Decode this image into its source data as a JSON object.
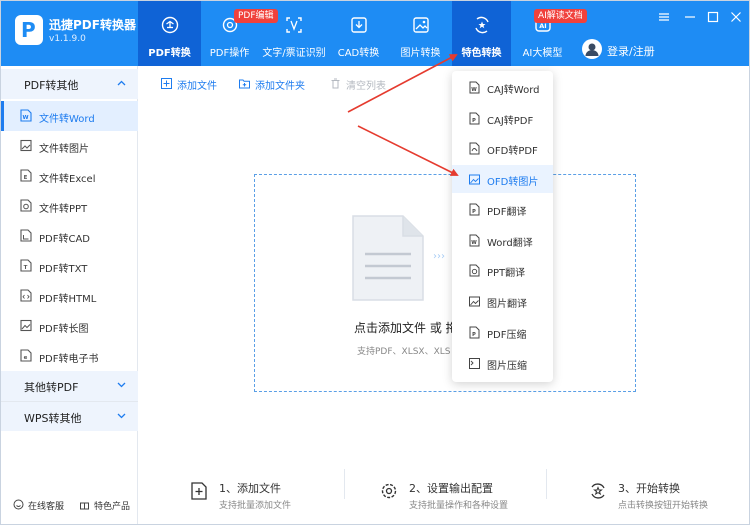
{
  "app": {
    "title": "迅捷PDF转换器",
    "version": "v1.1.9.0",
    "logo_letter": "P"
  },
  "nav": [
    {
      "label": "PDF转换",
      "icon": "refresh-icon",
      "active": true
    },
    {
      "label": "PDF操作",
      "icon": "gear-icon",
      "badge": "PDF编辑"
    },
    {
      "label": "文字/票证识别",
      "icon": "scan-icon"
    },
    {
      "label": "CAD转换",
      "icon": "download-box-icon"
    },
    {
      "label": "图片转换",
      "icon": "image-icon"
    },
    {
      "label": "特色转换",
      "icon": "star-refresh-icon",
      "active_dropdown": true
    },
    {
      "label": "AI大模型",
      "icon": "ai-icon",
      "badge": "AI解读文档"
    }
  ],
  "login": {
    "label": "登录/注册"
  },
  "sidebar": {
    "group1": {
      "label": "PDF转其他",
      "expanded": true
    },
    "items": [
      {
        "label": "文件转Word",
        "icon": "word-file-icon",
        "active": true
      },
      {
        "label": "文件转图片",
        "icon": "image-file-icon"
      },
      {
        "label": "文件转Excel",
        "icon": "excel-file-icon"
      },
      {
        "label": "文件转PPT",
        "icon": "ppt-file-icon"
      },
      {
        "label": "PDF转CAD",
        "icon": "cad-file-icon"
      },
      {
        "label": "PDF转TXT",
        "icon": "txt-file-icon"
      },
      {
        "label": "PDF转HTML",
        "icon": "html-file-icon"
      },
      {
        "label": "PDF转长图",
        "icon": "long-image-icon"
      },
      {
        "label": "PDF转电子书",
        "icon": "ebook-icon"
      }
    ],
    "group2": {
      "label": "其他转PDF"
    },
    "group3": {
      "label": "WPS转其他"
    },
    "footer": {
      "service": "在线客服",
      "products": "特色产品"
    }
  },
  "toolbar": {
    "add_file": "添加文件",
    "add_folder": "添加文件夹",
    "clear_list": "清空列表"
  },
  "dropzone": {
    "title": "点击添加文件 或 拖",
    "subtitle": "支持PDF、XLSX、XLS"
  },
  "steps": [
    {
      "title": "1、添加文件",
      "sub": "支持批量添加文件"
    },
    {
      "title": "2、设置输出配置",
      "sub": "支持批量操作和各种设置"
    },
    {
      "title": "3、开始转换",
      "sub": "点击转换按钮开始转换"
    }
  ],
  "dropdown": [
    {
      "label": "CAJ转Word",
      "icon": "word-icon"
    },
    {
      "label": "CAJ转PDF",
      "icon": "pdf-icon"
    },
    {
      "label": "OFD转PDF",
      "icon": "pdf-icon"
    },
    {
      "label": "OFD转图片",
      "icon": "image-icon",
      "highlighted": true
    },
    {
      "label": "PDF翻译",
      "icon": "pdf-icon"
    },
    {
      "label": "Word翻译",
      "icon": "word-icon"
    },
    {
      "label": "PPT翻译",
      "icon": "ppt-icon"
    },
    {
      "label": "图片翻译",
      "icon": "image-icon"
    },
    {
      "label": "PDF压缩",
      "icon": "pdf-icon"
    },
    {
      "label": "图片压缩",
      "icon": "image-compress-icon"
    }
  ],
  "colors": {
    "brand": "#1e8cf4",
    "active_nav": "#0f63d6",
    "badge": "#f0413c",
    "annotation_arrow": "#e53b2f"
  }
}
